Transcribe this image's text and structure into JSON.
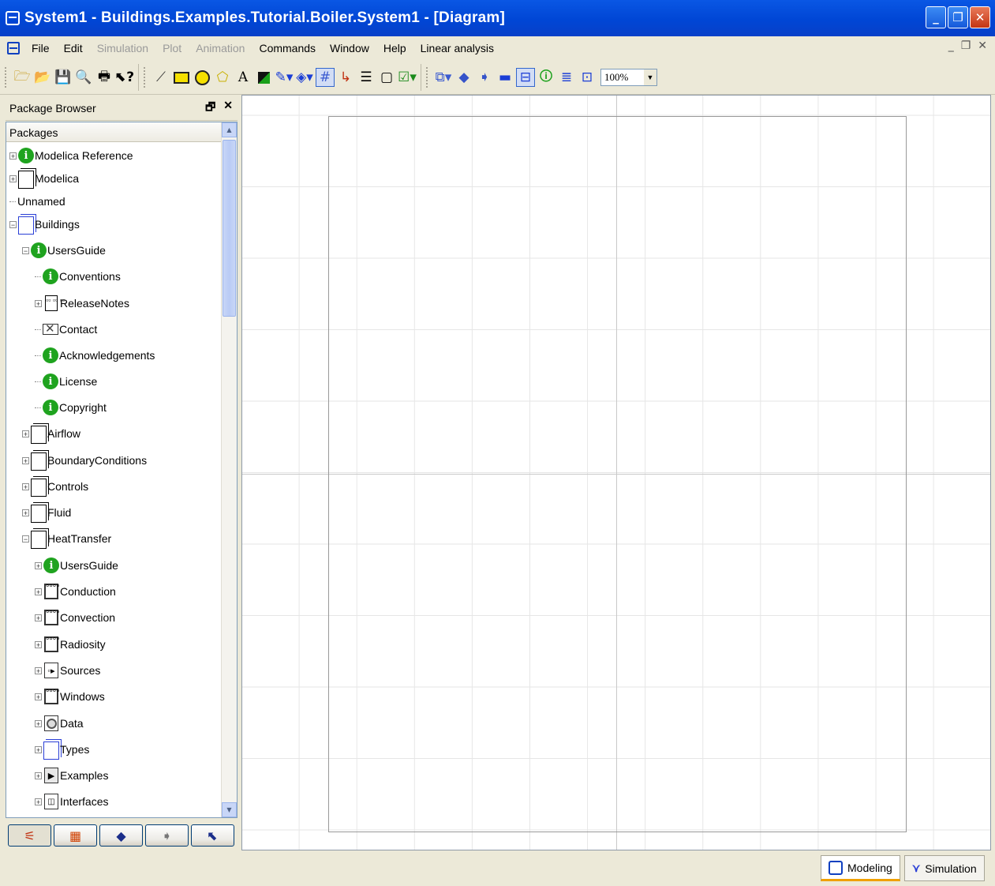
{
  "window": {
    "title": "System1  - Buildings.Examples.Tutorial.Boiler.System1  - [Diagram]"
  },
  "menu": [
    {
      "label": "File",
      "enabled": true
    },
    {
      "label": "Edit",
      "enabled": true
    },
    {
      "label": "Simulation",
      "enabled": false
    },
    {
      "label": "Plot",
      "enabled": false
    },
    {
      "label": "Animation",
      "enabled": false
    },
    {
      "label": "Commands",
      "enabled": true
    },
    {
      "label": "Window",
      "enabled": true
    },
    {
      "label": "Help",
      "enabled": true
    },
    {
      "label": "Linear analysis",
      "enabled": true
    }
  ],
  "toolbar": {
    "zoom": "100%"
  },
  "browser": {
    "title": "Package Browser",
    "column_header": "Packages",
    "tree": [
      {
        "label": "Modelica Reference",
        "icon": "info-icon",
        "level": 0,
        "expander": "plus"
      },
      {
        "label": "Modelica",
        "icon": "package-icon",
        "level": 0,
        "expander": "plus"
      },
      {
        "label": "Unnamed",
        "icon": "none",
        "level": 0,
        "expander": "dash"
      },
      {
        "label": "Buildings",
        "icon": "package-icon-blue",
        "level": 0,
        "expander": "minus"
      },
      {
        "label": "UsersGuide",
        "icon": "info-icon",
        "level": 1,
        "expander": "minus"
      },
      {
        "label": "Conventions",
        "icon": "info-icon",
        "level": 2,
        "expander": "dash"
      },
      {
        "label": "ReleaseNotes",
        "icon": "document-icon",
        "level": 2,
        "expander": "plus"
      },
      {
        "label": "Contact",
        "icon": "envelope-icon",
        "level": 2,
        "expander": "dash"
      },
      {
        "label": "Acknowledgements",
        "icon": "info-icon",
        "level": 2,
        "expander": "dash"
      },
      {
        "label": "License",
        "icon": "info-icon",
        "level": 2,
        "expander": "dash"
      },
      {
        "label": "Copyright",
        "icon": "info-icon",
        "level": 2,
        "expander": "dash"
      },
      {
        "label": "Airflow",
        "icon": "package-icon",
        "level": 1,
        "expander": "plus"
      },
      {
        "label": "BoundaryConditions",
        "icon": "package-icon",
        "level": 1,
        "expander": "plus"
      },
      {
        "label": "Controls",
        "icon": "package-icon",
        "level": 1,
        "expander": "plus"
      },
      {
        "label": "Fluid",
        "icon": "package-icon",
        "level": 1,
        "expander": "plus"
      },
      {
        "label": "HeatTransfer",
        "icon": "package-icon",
        "level": 1,
        "expander": "minus"
      },
      {
        "label": "UsersGuide",
        "icon": "info-icon",
        "level": 2,
        "expander": "plus"
      },
      {
        "label": "Conduction",
        "icon": "component-grid-icon",
        "level": 2,
        "expander": "plus"
      },
      {
        "label": "Convection",
        "icon": "component-grid-icon",
        "level": 2,
        "expander": "plus"
      },
      {
        "label": "Radiosity",
        "icon": "component-grid-icon",
        "level": 2,
        "expander": "plus"
      },
      {
        "label": "Sources",
        "icon": "source-icon",
        "level": 2,
        "expander": "plus"
      },
      {
        "label": "Windows",
        "icon": "component-grid-icon",
        "level": 2,
        "expander": "plus"
      },
      {
        "label": "Data",
        "icon": "data-record-icon",
        "level": 2,
        "expander": "plus"
      },
      {
        "label": "Types",
        "icon": "package-icon-blue",
        "level": 2,
        "expander": "plus"
      },
      {
        "label": "Examples",
        "icon": "play-icon",
        "level": 2,
        "expander": "plus"
      },
      {
        "label": "Interfaces",
        "icon": "interface-icon",
        "level": 2,
        "expander": "plus"
      }
    ]
  },
  "status": {
    "modeling_label": "Modeling",
    "simulation_label": "Simulation"
  }
}
